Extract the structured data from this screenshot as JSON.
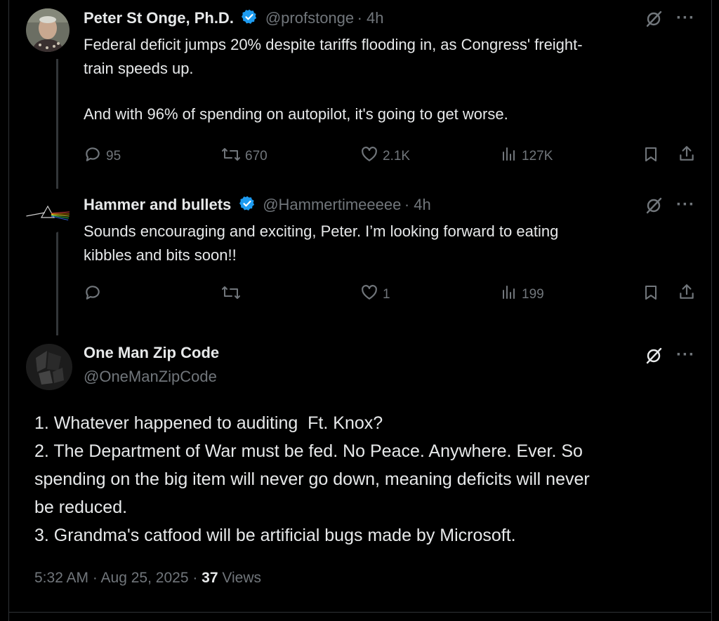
{
  "colors": {
    "background": "#000000",
    "text": "#e7e9ea",
    "secondary": "#71767b",
    "verified": "#1d9bf0"
  },
  "tweet1": {
    "name": "Peter St Onge, Ph.D.",
    "handle": "@profstonge",
    "time": "· 4h",
    "line1": "Federal deficit jumps 20% despite tariffs flooding in, as Congress' freight-",
    "line2": "train speeds up.",
    "line3": "And with 96% of spending on autopilot, it's going to get worse.",
    "replies": "95",
    "reposts": "670",
    "likes": "2.1K",
    "views": "127K"
  },
  "tweet2": {
    "name": "Hammer and bullets",
    "handle": "@Hammertimeeeee",
    "time": "· 4h",
    "line1": "Sounds encouraging and exciting, Peter. I’m looking forward to eating",
    "line2": "kibbles and bits soon!!",
    "replies": "",
    "reposts": "",
    "likes": "1",
    "views": "199"
  },
  "tweet3": {
    "name": "One Man Zip Code",
    "handle": "@OneManZipCode",
    "lines": [
      "1. Whatever happened to auditing  Ft. Knox?",
      "2. The Department of War must be fed. No Peace. Anywhere. Ever. So",
      "spending on the big item will never go down, meaning deficits will never",
      "be reduced.",
      "3. Grandma's catfood will be artificial bugs made by Microsoft."
    ],
    "timestamp": "5:32 AM · Aug 25, 2025 · ",
    "views_count": "37",
    "views_label": " Views"
  },
  "icons": {
    "more": "···",
    "verified": "verified-badge-icon",
    "grok": "grok-icon"
  }
}
